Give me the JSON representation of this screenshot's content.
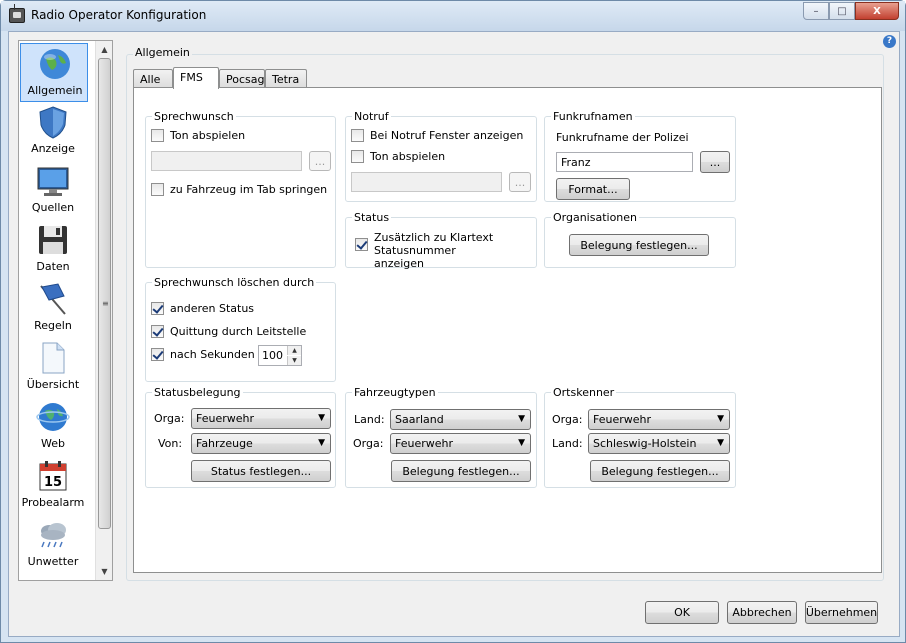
{
  "window": {
    "title": "Radio Operator Konfiguration",
    "minimize": "–",
    "maximize": "□",
    "close": "X"
  },
  "help_label": "?",
  "sidebar": {
    "items": [
      {
        "label": "Allgemein",
        "icon": "globe-icon",
        "selected": true
      },
      {
        "label": "Anzeige",
        "icon": "shield-icon"
      },
      {
        "label": "Quellen",
        "icon": "monitor-icon"
      },
      {
        "label": "Daten",
        "icon": "floppy-disk-icon"
      },
      {
        "label": "Regeln",
        "icon": "flag-icon"
      },
      {
        "label": "Übersicht",
        "icon": "document-icon"
      },
      {
        "label": "Web",
        "icon": "web-globe-icon"
      },
      {
        "label": "Probealarm",
        "icon": "calendar-icon"
      },
      {
        "label": "Unwetter",
        "icon": "cloud-icon"
      }
    ],
    "calendar_day": "15",
    "scroll_up": "▲",
    "scroll_down": "▼",
    "grip": "≡"
  },
  "main_group_title": "Allgemein",
  "tabs": [
    {
      "label": "Alle"
    },
    {
      "label": "FMS",
      "active": true
    },
    {
      "label": "Pocsag"
    },
    {
      "label": "Tetra"
    }
  ],
  "sprechwunsch": {
    "title": "Sprechwunsch",
    "ton_abspielen": "Ton abspielen",
    "file_value": "",
    "browse": "...",
    "zu_fahrzeug": "zu Fahrzeug im Tab springen"
  },
  "notruf": {
    "title": "Notruf",
    "fenster_anzeigen": "Bei Notruf Fenster anzeigen",
    "ton_abspielen": "Ton abspielen",
    "file_value": "",
    "browse": "..."
  },
  "funkrufnamen": {
    "title": "Funkrufnamen",
    "label": "Funkrufname der Polizei",
    "value": "Franz",
    "browse": "...",
    "format_button": "Format..."
  },
  "status": {
    "title": "Status",
    "klartext": "Zusätzlich zu Klartext Statusnummer anzeigen",
    "klartext_checked": true
  },
  "organisationen": {
    "title": "Organisationen",
    "button": "Belegung festlegen..."
  },
  "loeschen": {
    "title": "Sprechwunsch löschen durch",
    "anderen_status": "anderen Status",
    "quittung": "Quittung durch Leitstelle",
    "nach_sekunden": "nach Sekunden",
    "seconds": "100",
    "spin_up": "▲",
    "spin_down": "▼"
  },
  "statusbelegung": {
    "title": "Statusbelegung",
    "orga_label": "Orga:",
    "orga_value": "Feuerwehr",
    "von_label": "Von:",
    "von_value": "Fahrzeuge",
    "button": "Status festlegen..."
  },
  "fahrzeugtypen": {
    "title": "Fahrzeugtypen",
    "land_label": "Land:",
    "land_value": "Saarland",
    "orga_label": "Orga:",
    "orga_value": "Feuerwehr",
    "button": "Belegung festlegen..."
  },
  "ortskenner": {
    "title": "Ortskenner",
    "orga_label": "Orga:",
    "orga_value": "Feuerwehr",
    "land_label": "Land:",
    "land_value": "Schleswig-Holstein",
    "button": "Belegung festlegen..."
  },
  "dropdown_arrow": "▼",
  "footer": {
    "ok": "OK",
    "cancel": "Abbrechen",
    "apply": "Übernehmen"
  }
}
